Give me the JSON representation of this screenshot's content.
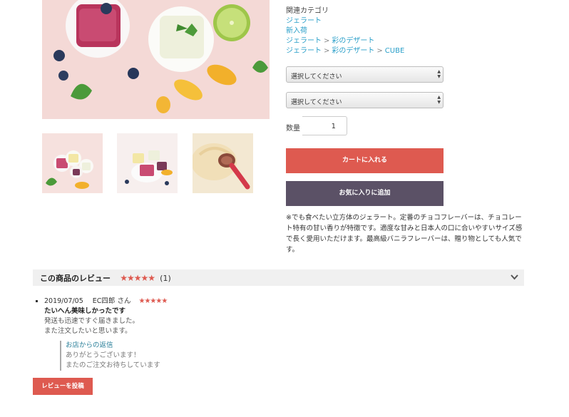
{
  "category": {
    "label": "関連カテゴリ",
    "links": [
      [
        "ジェラート"
      ],
      [
        "新入荷"
      ],
      [
        "ジェラート",
        "彩のデザート"
      ],
      [
        "ジェラート",
        "彩のデザート",
        "CUBE"
      ]
    ],
    "separator": ">"
  },
  "options": {
    "select1_value": "選択してください",
    "select2_value": "選択してください"
  },
  "quantity": {
    "label": "数量",
    "value": "1"
  },
  "buttons": {
    "add_to_cart": "カートに入れる",
    "add_to_favorites": "お気に入りに追加",
    "post_review": "レビューを投稿"
  },
  "description": "※でも食べたい立方体のジェラート。定番のチョコフレーバーは、チョコレート特有の甘い香りが特徴です。適度な甘みと日本人の口に合いやすいサイズ感で長く愛用いただけます。最高級バニラフレーバーは、贈り物としても人気です。",
  "reviews": {
    "section_title": "この商品のレビュー",
    "stars": "★★★★★",
    "count": "(1)",
    "items": [
      {
        "date": "2019/07/05",
        "name": "EC四郎 さん",
        "stars": "★★★★★",
        "title": "たいへん美味しかったです",
        "body_line1": "発送も迅速ですぐ届きました。",
        "body_line2": "また注文したいと思います。",
        "reply_title": "お店からの返信",
        "reply_line1": "ありがとうございます！",
        "reply_line2": "またのご注文お待ちしています"
      }
    ]
  },
  "icons": {
    "chevron": "chevron-down-icon",
    "select_arrows": "select-arrows-icon"
  },
  "colors": {
    "accent": "#de5a50",
    "secondary": "#5b5166",
    "link": "#2a9fc9"
  }
}
